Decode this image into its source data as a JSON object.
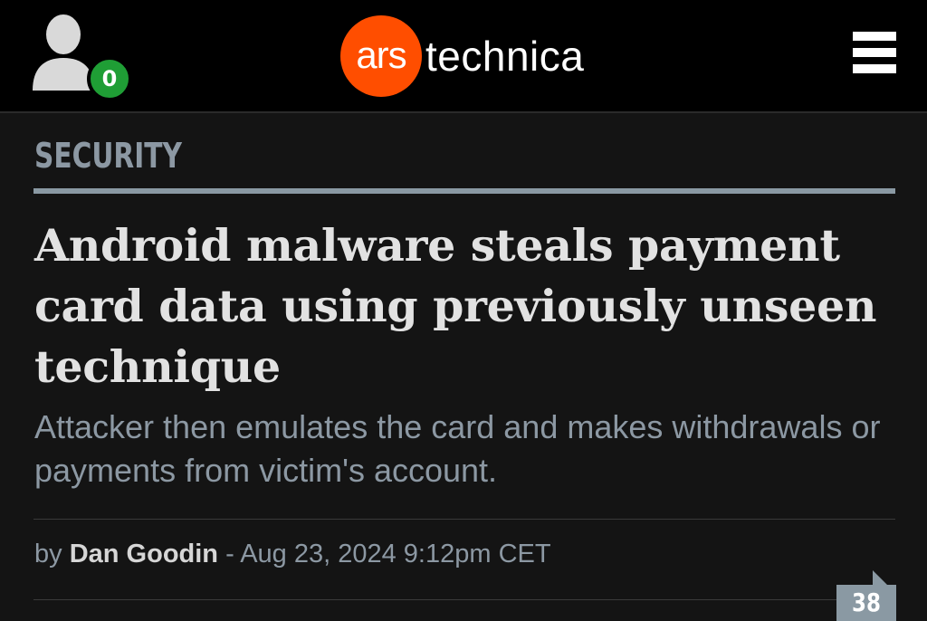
{
  "header": {
    "notification_count": "0",
    "logo_badge_text": "ars",
    "logo_text": "technica",
    "icons": {
      "user": "user-silhouette-icon",
      "menu": "hamburger-menu-icon",
      "comments": "comment-bubble-icon"
    }
  },
  "article": {
    "section": "SECURITY",
    "headline": "Android malware steals payment card data using previously unseen technique",
    "dek": "Attacker then emulates the card and makes withdrawals or payments from victim's account.",
    "byline": {
      "prefix": "by",
      "author": "Dan Goodin",
      "separator": " - ",
      "date": "Aug 23, 2024 9:12pm CET"
    },
    "comment_count": "38"
  },
  "colors": {
    "background": "#141414",
    "header_background": "#000000",
    "logo_accent": "#ff4e00",
    "notification_badge": "#1f9e35",
    "muted_text": "#8c98a3",
    "headline_text": "#e2e2e2"
  }
}
